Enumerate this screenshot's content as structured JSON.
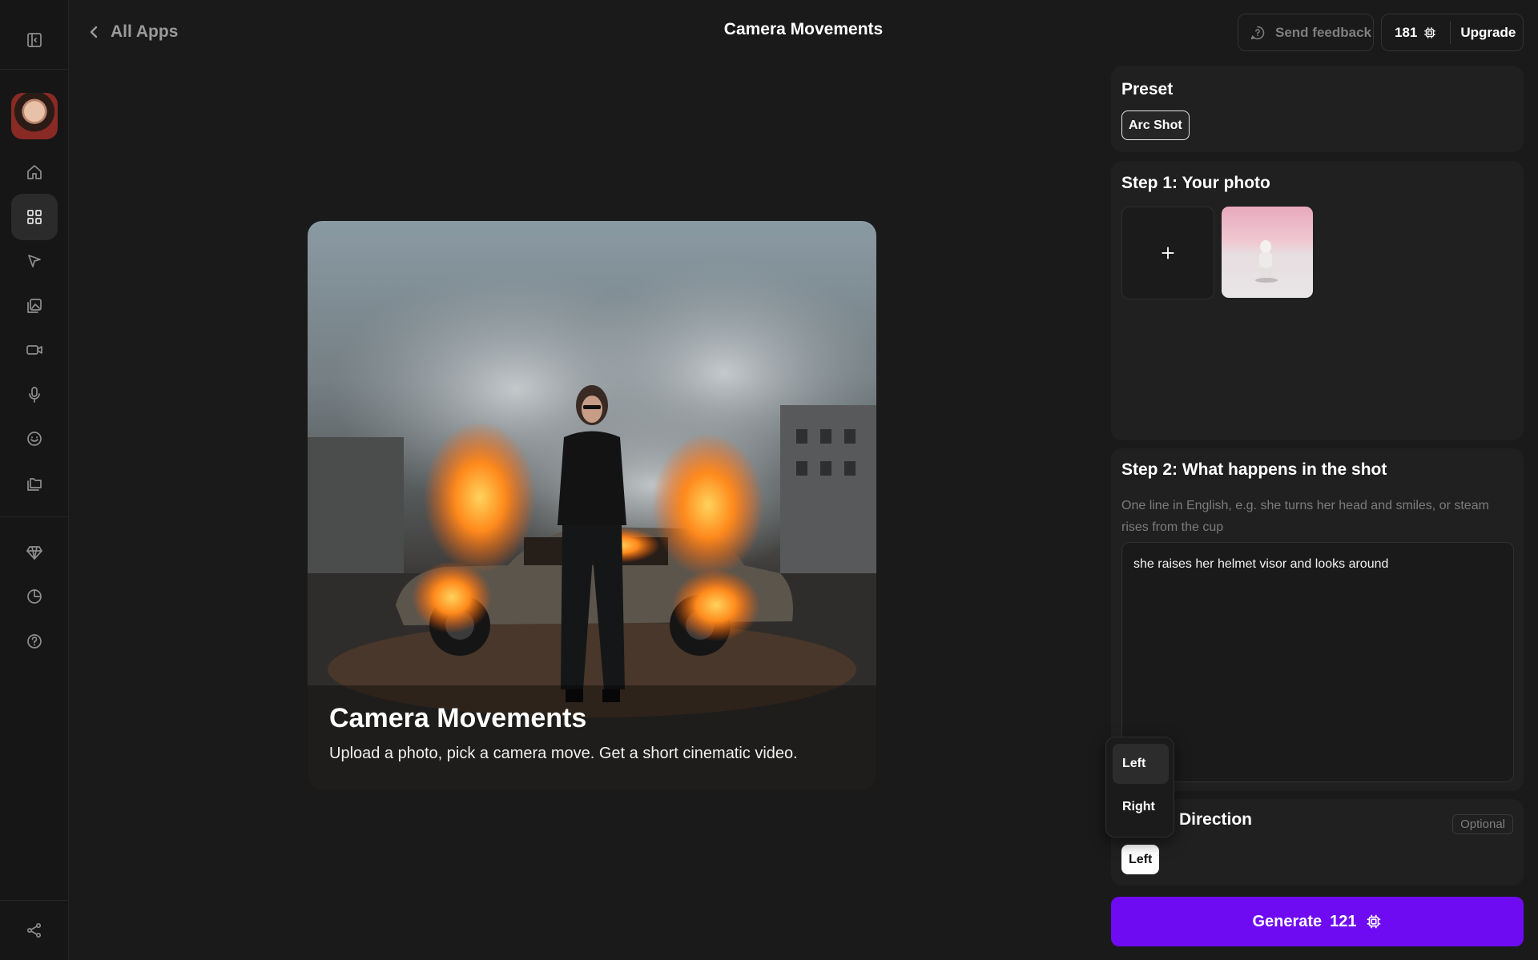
{
  "nav": {
    "back_label": "All Apps",
    "page_title": "Camera Movements"
  },
  "topbar": {
    "feedback_label": "Send feedback",
    "credits": "181",
    "upgrade_label": "Upgrade"
  },
  "sidebar": {
    "icons": [
      "panel-toggle-icon",
      "home-icon",
      "apps-grid-icon",
      "cursor-icon",
      "image-edit-icon",
      "video-icon",
      "microphone-icon",
      "smiley-icon",
      "folders-icon",
      "diamond-icon",
      "pie-chart-icon",
      "help-icon",
      "share-icon"
    ],
    "active": "apps-grid-icon"
  },
  "hero": {
    "title": "Camera Movements",
    "subtitle": "Upload a photo, pick a camera move. Get a short cinematic video."
  },
  "preset": {
    "title": "Preset",
    "selected": "Arc Shot"
  },
  "step1": {
    "title": "Step 1: Your photo"
  },
  "step2": {
    "title": "Step 2: What happens in the shot",
    "hint": "One line in English, e.g. she turns her head and smiles, or steam rises from the cup",
    "prompt_value": "she raises her helmet visor and looks around"
  },
  "step3": {
    "title_visible": "Direction",
    "optional_label": "Optional",
    "selected": "Left",
    "options": [
      "Left",
      "Right"
    ]
  },
  "generate": {
    "label": "Generate",
    "cost": "121"
  },
  "colors": {
    "accent": "#6e0bf3",
    "background": "#1a1a1a",
    "card": "#202020"
  }
}
